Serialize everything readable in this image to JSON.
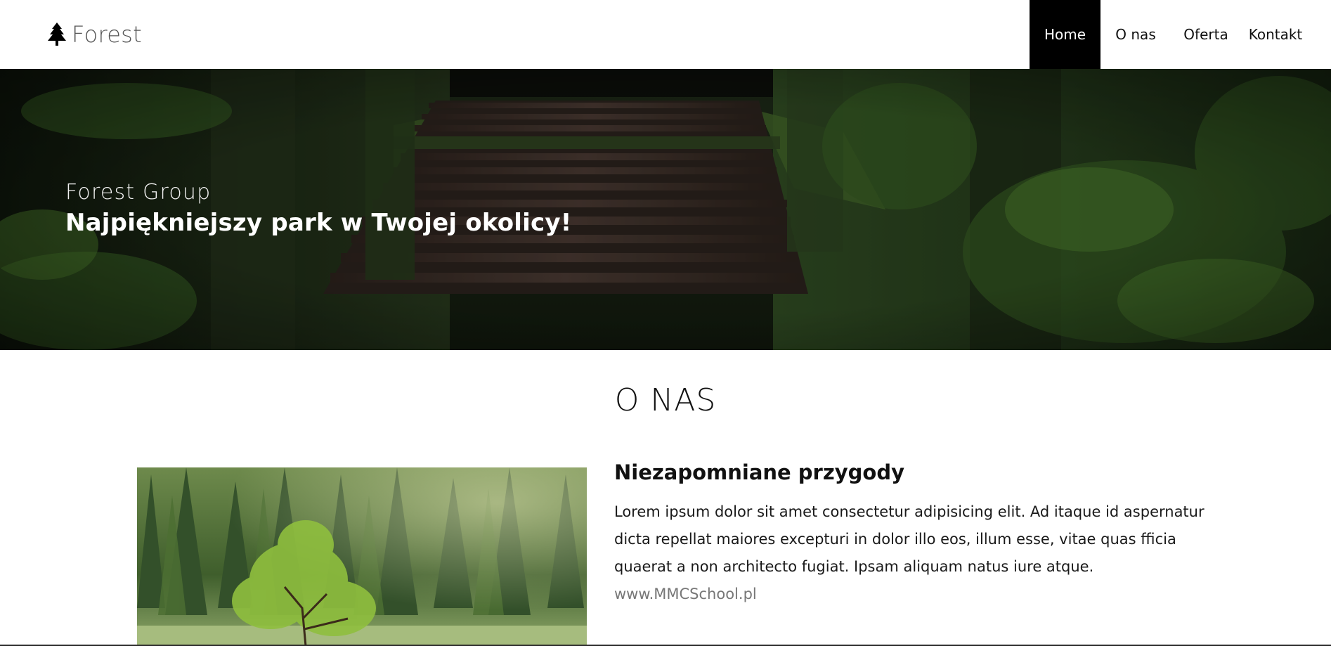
{
  "navbar": {
    "brand_label": "Forest",
    "brand_icon": "tree-icon",
    "items": [
      {
        "label": "Home",
        "active": true
      },
      {
        "label": "O nas",
        "active": false
      },
      {
        "label": "Oferta",
        "active": false
      },
      {
        "label": "Kontakt",
        "active": false
      }
    ]
  },
  "hero": {
    "subtitle": "Forest Group",
    "title": "Najpiękniejszy park w Twojej okolicy!"
  },
  "about": {
    "section_title": "O NAS",
    "heading": "Niezapomniane przygody",
    "paragraph": "Lorem ipsum dolor sit amet consectetur adipisicing elit. Ad itaque id aspernatur dicta repellat maiores excepturi in dolor illo eos, illum esse, vitae quas fficia quaerat a non architecto fugiat. Ipsam aliquam natus iure atque.",
    "link_text": "www.MMCSchool.pl"
  },
  "colors": {
    "active_nav_bg": "#000000",
    "active_nav_text": "#ffffff",
    "link": "#777777"
  }
}
